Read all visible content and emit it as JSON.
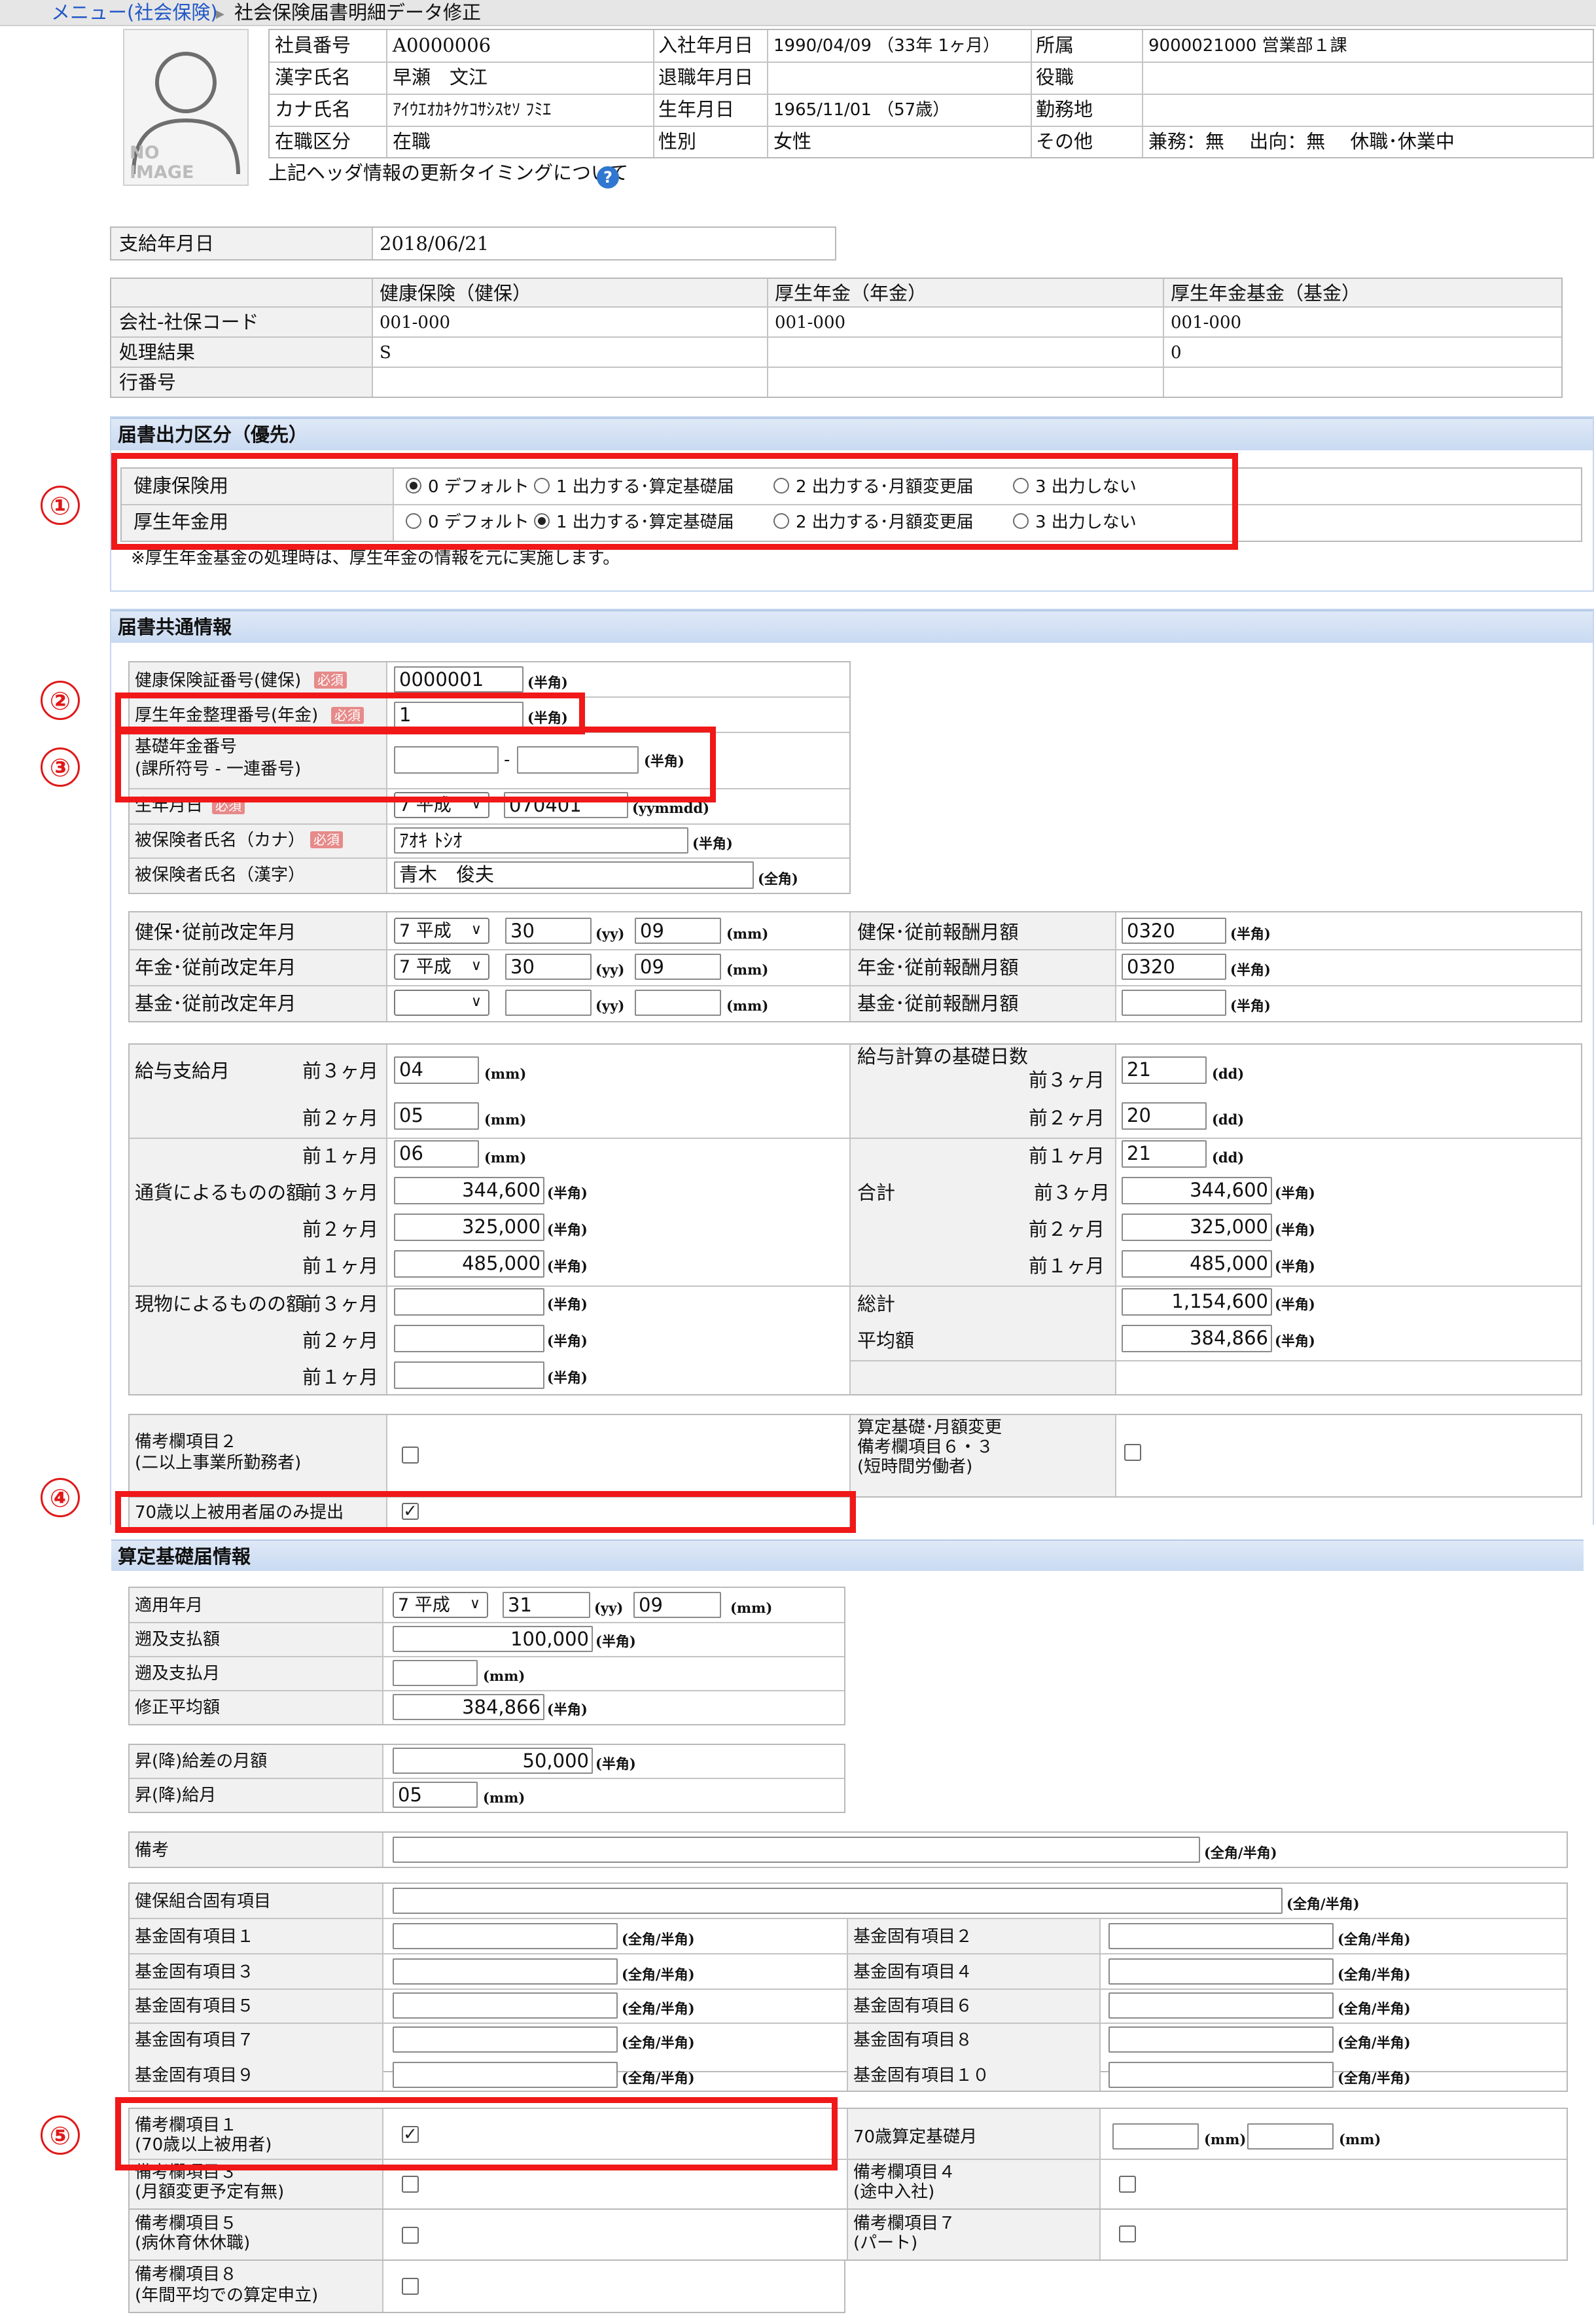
{
  "breadcrumb": {
    "menu": "メニュー(社会保険)",
    "sep": "▸",
    "current": "社会保険届書明細データ修正"
  },
  "avatar": {
    "line1": "NO",
    "line2": "IMAGE"
  },
  "employee": {
    "id_label": "社員番号",
    "id": "A0000006",
    "kanji_label": "漢字氏名",
    "kanji": "早瀬　文江",
    "kana_label": "カナ氏名",
    "kana": "ｱｲｳｴｵｶｷｸｹｺｻｼｽｾｿ ﾌﾐｴ",
    "status_label": "在職区分",
    "status": "在職",
    "join_label": "入社年月日",
    "join": "1990/04/09 （33年 1ヶ月）",
    "leave_label": "退職年月日",
    "leave": "",
    "birth_label": "生年月日",
    "birth": "1965/11/01 （57歳）",
    "sex_label": "性別",
    "sex": "女性",
    "dept_label": "所属",
    "dept": "9000021000 営業部１課",
    "role_label": "役職",
    "role": "",
    "site_label": "勤務地",
    "site": "",
    "other_label": "その他",
    "other": "兼務：無　 出向：無　 休職･休業中"
  },
  "header_note": "上記ヘッダ情報の更新タイミングについて",
  "payday": {
    "label": "支給年月日",
    "value": "2018/06/21"
  },
  "codes": {
    "col_health": "健康保険（健保）",
    "col_pension": "厚生年金（年金）",
    "col_fund": "厚生年金基金（基金）",
    "row_company": "会社-社保コード",
    "row_result": "処理結果",
    "row_line": "行番号",
    "health_company": "001-000",
    "pension_company": "001-000",
    "fund_company": "001-000",
    "health_result": "S",
    "pension_result": "",
    "fund_result": "0"
  },
  "output_section": {
    "title": "届書出力区分（優先）",
    "health_label": "健康保険用",
    "pension_label": "厚生年金用",
    "options": [
      "0 デフォルト",
      "1 出力する･算定基礎届",
      "2 出力する･月額変更届",
      "3 出力しない"
    ],
    "health_selected": 0,
    "pension_selected": 1,
    "note": "※厚生年金基金の処理時は、厚生年金の情報を元に実施します。"
  },
  "common_section": {
    "title": "届書共通情報",
    "required": "必須",
    "hi_card_label": "健康保険証番号(健保)",
    "hi_card": "0000001",
    "pension_no_label": "厚生年金整理番号(年金)",
    "pension_no": "1",
    "basic_no_label1": "基礎年金番号",
    "basic_no_label2": "(課所符号 - 一連番号)",
    "basic_no_a": "",
    "basic_no_b": "",
    "dash": "-",
    "birth_label": "生年月日",
    "birth_era": "7 平成",
    "birth_value": "070401",
    "birth_unit": "(yymmdd)",
    "kana_label": "被保険者氏名（カナ）",
    "kana": "ｱｵｷ ﾄｼｵ",
    "kanji_label": "被保険者氏名（漢字）",
    "kanji": "青木　俊夫",
    "u_half": "(半角)",
    "u_full": "(全角)",
    "u_yy": "(yy)",
    "u_mm": "(mm)",
    "u_dd": "(dd)",
    "u_both": "(全角/半角)",
    "prev_health_label": "健保･従前改定年月",
    "prev_health_era": "7 平成",
    "prev_health_yy": "30",
    "prev_health_mm": "09",
    "prev_pension_label": "年金･従前改定年月",
    "prev_pension_era": "7 平成",
    "prev_pension_yy": "30",
    "prev_pension_mm": "09",
    "prev_fund_label": "基金･従前改定年月",
    "prev_fund_era": "",
    "prev_fund_yy": "",
    "prev_fund_mm": "",
    "rem_health_label": "健保･従前報酬月額",
    "rem_health": "0320",
    "rem_pension_label": "年金･従前報酬月額",
    "rem_pension": "0320",
    "rem_fund_label": "基金･従前報酬月額",
    "rem_fund": "",
    "pay_month_label": "給与支給月",
    "m3": "前３ヶ月",
    "m2": "前２ヶ月",
    "m1": "前１ヶ月",
    "pay_m3": "04",
    "pay_m2": "05",
    "pay_m1": "06",
    "days_label": "給与計算の基礎日数",
    "days_m3": "21",
    "days_m2": "20",
    "days_m1": "21",
    "cash_label": "通貨によるものの額",
    "cash_m3": "344,600",
    "cash_m2": "325,000",
    "cash_m1": "485,000",
    "kind_label": "現物によるものの額",
    "kind_m3": "",
    "kind_m2": "",
    "kind_m1": "",
    "sum_label": "合計",
    "sum_m3": "344,600",
    "sum_m2": "325,000",
    "sum_m1": "485,000",
    "total_label": "総計",
    "total": "1,154,600",
    "avg_label": "平均額",
    "avg": "384,866",
    "remark2_label1": "備考欄項目２",
    "remark2_label2": "(二以上事業所勤務者)",
    "remark2_checked": false,
    "remark63_label1": "算定基礎･月額変更",
    "remark63_label2": "備考欄項目６・３",
    "remark63_label3": "(短時間労働者)",
    "remark63_checked": false,
    "over70_label": "70歳以上被用者届のみ提出",
    "over70_checked": true
  },
  "calc_section": {
    "title": "算定基礎届情報",
    "apply_label": "適用年月",
    "apply_era": "7 平成",
    "apply_yy": "31",
    "apply_mm": "09",
    "retro_amount_label": "遡及支払額",
    "retro_amount": "100,000",
    "retro_month_label": "遡及支払月",
    "retro_month": "",
    "adj_avg_label": "修正平均額",
    "adj_avg": "384,866",
    "diff_label": "昇(降)給差の月額",
    "diff": "50,000",
    "raise_month_label": "昇(降)給月",
    "raise_month": "05",
    "memo_label": "備考",
    "memo": "",
    "union_label": "健保組合固有項目",
    "union": "",
    "fund_items": [
      "基金固有項目１",
      "基金固有項目２",
      "基金固有項目３",
      "基金固有項目４",
      "基金固有項目５",
      "基金固有項目６",
      "基金固有項目７",
      "基金固有項目８",
      "基金固有項目９",
      "基金固有項目１０"
    ],
    "r1_label1": "備考欄項目１",
    "r1_label2": "(70歳以上被用者)",
    "r1_checked": true,
    "b70_label": "70歳算定基礎月",
    "b70_a": "",
    "b70_b": "",
    "r3_label1": "備考欄項目３",
    "r3_label2": "(月額変更予定有無)",
    "r3_checked": false,
    "r4_label1": "備考欄項目４",
    "r4_label2": "(途中入社)",
    "r4_checked": false,
    "r5_label1": "備考欄項目５",
    "r5_label2": "(病休育休休職)",
    "r5_checked": false,
    "r7_label1": "備考欄項目７",
    "r7_label2": "(パート)",
    "r7_checked": false,
    "r8_label1": "備考欄項目８",
    "r8_label2": "(年間平均での算定申立)",
    "r8_checked": false
  },
  "markers": [
    "①",
    "②",
    "③",
    "④",
    "⑤"
  ],
  "icons": {
    "help": "?",
    "dropdown": "∨",
    "check": "✓"
  },
  "colors": {
    "highlight": "#f01818",
    "section_bg": "#d2e0f4",
    "link": "#2257c7"
  }
}
